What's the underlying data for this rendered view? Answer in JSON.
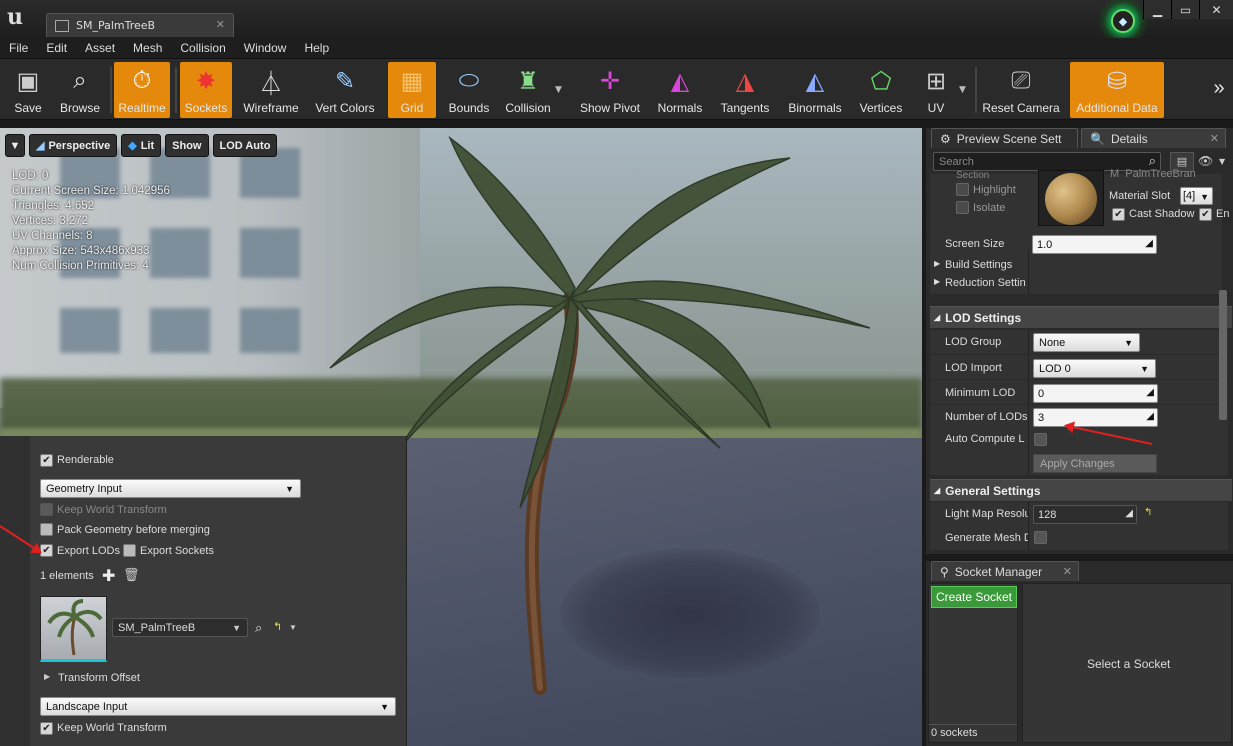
{
  "window": {
    "tab_title": "SM_PalmTreeB",
    "tab_close": "✕",
    "minimize": "▁",
    "maximize": "▭",
    "close": "✕"
  },
  "menu": [
    "File",
    "Edit",
    "Asset",
    "Mesh",
    "Collision",
    "Window",
    "Help"
  ],
  "toolbar": {
    "save": "Save",
    "browse": "Browse",
    "realtime": "Realtime",
    "sockets": "Sockets",
    "wireframe": "Wireframe",
    "vert_colors": "Vert Colors",
    "grid": "Grid",
    "bounds": "Bounds",
    "collision": "Collision",
    "show_pivot": "Show Pivot",
    "normals": "Normals",
    "tangents": "Tangents",
    "binormals": "Binormals",
    "vertices": "Vertices",
    "uv": "UV",
    "reset_camera": "Reset Camera",
    "additional_data": "Additional Data",
    "more": "»"
  },
  "viewport": {
    "perspective": "Perspective",
    "lit": "Lit",
    "show": "Show",
    "lod_auto": "LOD Auto",
    "stats": [
      "LOD:  0",
      "Current Screen Size:  1.042956",
      "Triangles:  4,652",
      "Vertices:  3,272",
      "UV Channels:  8",
      "Approx Size: 543x486x933",
      "Num Collision Primitives:  4"
    ]
  },
  "hlod_panel": {
    "renderable": "Renderable",
    "geometry_input": "Geometry Input",
    "keep_world_transform": "Keep World Transform",
    "pack_geometry": "Pack Geometry before merging",
    "export_lods": "Export LODs",
    "export_sockets": "Export Sockets",
    "elements": "1 elements",
    "mesh_name": "SM_PalmTreeB",
    "transform_offset": "Transform Offset",
    "landscape_input": "Landscape Input",
    "keep_world_transform2": "Keep World Transform"
  },
  "details": {
    "tab_preview": "Preview Scene Sett",
    "tab_details": "Details",
    "search_placeholder": "Search",
    "section_cut": "Section",
    "material_cut": "M_PalmTreeBran",
    "highlight": "Highlight",
    "isolate": "Isolate",
    "material_slot": "Material Slot",
    "material_slot_value": "[4]",
    "cast_shadow": "Cast Shadow",
    "enable_cut": "Ena",
    "screen_size": "Screen Size",
    "screen_size_value": "1.0",
    "build_settings": "Build Settings",
    "reduction_settings": "Reduction Settin",
    "lod_settings": "LOD Settings",
    "lod_group": "LOD Group",
    "lod_group_value": "None",
    "lod_import": "LOD Import",
    "lod_import_value": "LOD 0",
    "minimum_lod": "Minimum LOD",
    "minimum_lod_value": "0",
    "number_of_lods": "Number of LODs",
    "number_of_lods_value": "3",
    "auto_compute": "Auto Compute L",
    "apply_changes": "Apply Changes",
    "general_settings": "General Settings",
    "light_map": "Light Map Resolu",
    "light_map_value": "128",
    "generate_mesh": "Generate Mesh D"
  },
  "socket_manager": {
    "tab": "Socket Manager",
    "create": "Create Socket",
    "select": "Select a Socket",
    "count": "0 sockets"
  },
  "colors": {
    "accent_orange": "#e5890c",
    "create_green": "#3a9a3a",
    "annotation_red": "#e02020"
  }
}
